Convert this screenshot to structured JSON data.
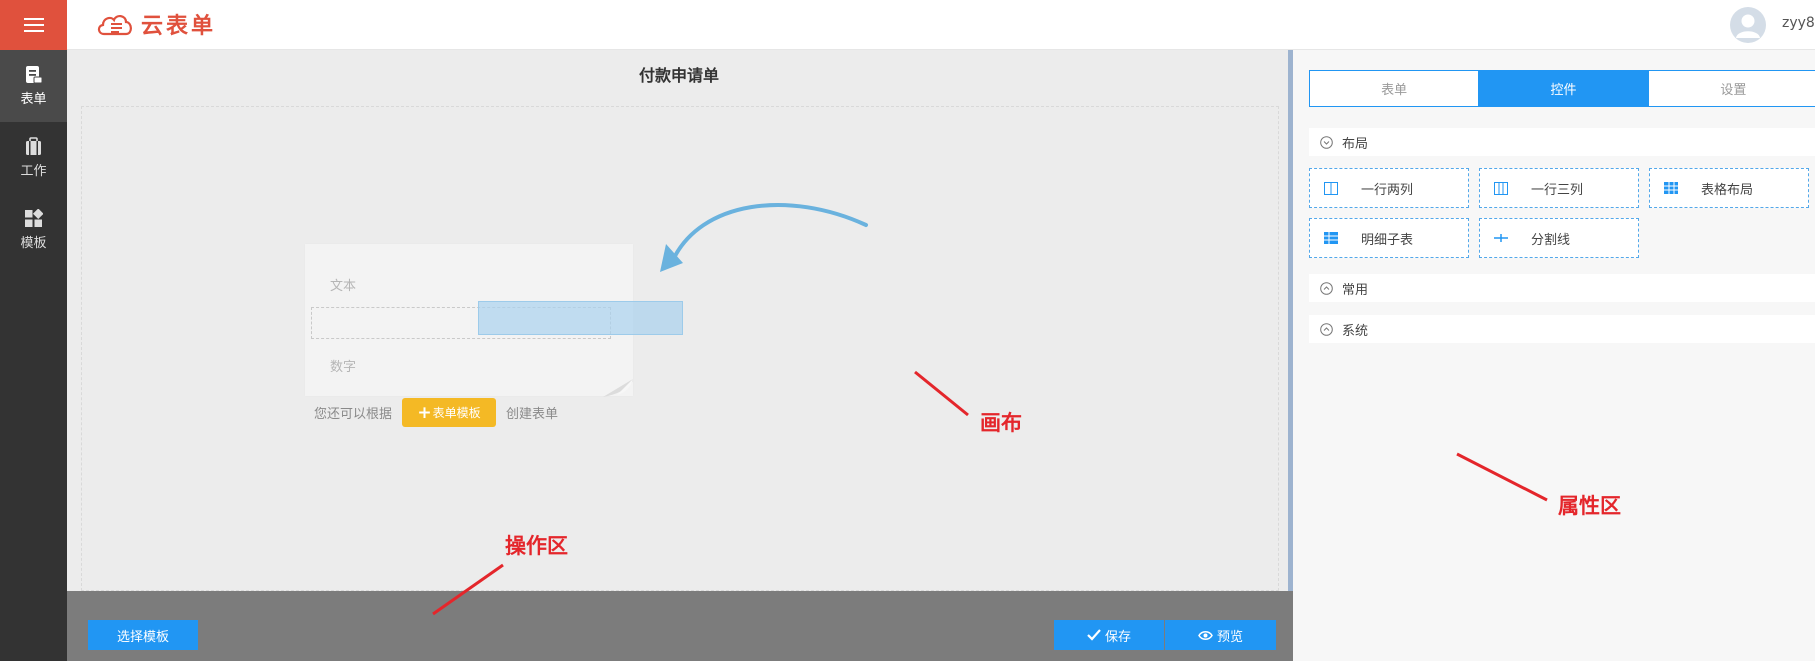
{
  "app": {
    "logo_text": "云表单",
    "username": "zyy8"
  },
  "nav": {
    "items": [
      {
        "label": "表单",
        "icon": "form-icon",
        "active": true
      },
      {
        "label": "工作",
        "icon": "briefcase-icon",
        "active": false
      },
      {
        "label": "模板",
        "icon": "template-icon",
        "active": false
      }
    ]
  },
  "canvas": {
    "title": "付款申请单",
    "demo_text_label": "文本",
    "demo_number_label": "数字",
    "hint_prefix": "您还可以根据",
    "template_button": "表单模板",
    "hint_suffix": "创建表单"
  },
  "toolbar": {
    "select_template": "选择模板",
    "save": "保存",
    "preview": "预览"
  },
  "panel": {
    "tabs": [
      "表单",
      "控件",
      "设置"
    ],
    "active_tab": "控件",
    "sections": {
      "layout": "布局",
      "common": "常用",
      "system": "系统"
    },
    "layout_controls": [
      {
        "label": "一行两列",
        "icon": "two-column-icon"
      },
      {
        "label": "一行三列",
        "icon": "three-column-icon"
      },
      {
        "label": "表格布局",
        "icon": "table-layout-icon"
      },
      {
        "label": "明细子表",
        "icon": "sub-table-icon"
      },
      {
        "label": "分割线",
        "icon": "divider-icon"
      }
    ]
  },
  "annotations": {
    "canvas": "画布",
    "property_area": "属性区",
    "operation_area": "操作区"
  },
  "colors": {
    "brand": "#e0513d",
    "accent": "#2196f3",
    "annotation": "#e4262b",
    "template_button": "#f4b925"
  }
}
